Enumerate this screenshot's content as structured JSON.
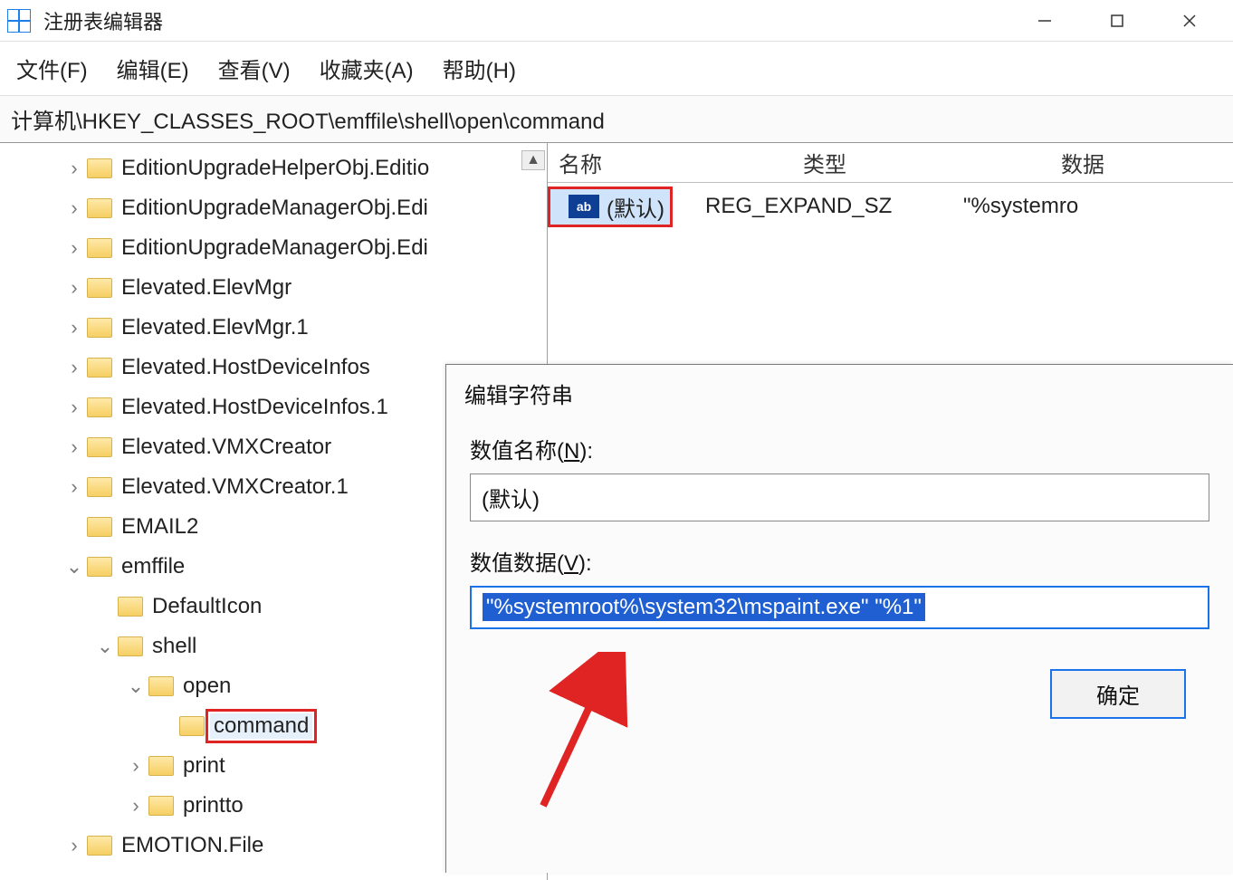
{
  "window": {
    "title": "注册表编辑器"
  },
  "menu": {
    "file": "文件(F)",
    "edit": "编辑(E)",
    "view": "查看(V)",
    "fav": "收藏夹(A)",
    "help": "帮助(H)"
  },
  "address": "计算机\\HKEY_CLASSES_ROOT\\emffile\\shell\\open\\command",
  "tree": [
    {
      "indent": 2,
      "exp": "closed",
      "label": "EditionUpgradeHelperObj.Editio"
    },
    {
      "indent": 2,
      "exp": "closed",
      "label": "EditionUpgradeManagerObj.Edi"
    },
    {
      "indent": 2,
      "exp": "closed",
      "label": "EditionUpgradeManagerObj.Edi"
    },
    {
      "indent": 2,
      "exp": "closed",
      "label": "Elevated.ElevMgr"
    },
    {
      "indent": 2,
      "exp": "closed",
      "label": "Elevated.ElevMgr.1"
    },
    {
      "indent": 2,
      "exp": "closed",
      "label": "Elevated.HostDeviceInfos"
    },
    {
      "indent": 2,
      "exp": "closed",
      "label": "Elevated.HostDeviceInfos.1"
    },
    {
      "indent": 2,
      "exp": "closed",
      "label": "Elevated.VMXCreator"
    },
    {
      "indent": 2,
      "exp": "closed",
      "label": "Elevated.VMXCreator.1"
    },
    {
      "indent": 2,
      "exp": "none",
      "label": "EMAIL2"
    },
    {
      "indent": 2,
      "exp": "open",
      "label": "emffile"
    },
    {
      "indent": 3,
      "exp": "none",
      "label": "DefaultIcon"
    },
    {
      "indent": 3,
      "exp": "open",
      "label": "shell"
    },
    {
      "indent": 4,
      "exp": "open",
      "label": "open"
    },
    {
      "indent": 5,
      "exp": "none",
      "label": "command",
      "selected": true
    },
    {
      "indent": 4,
      "exp": "closed",
      "label": "print"
    },
    {
      "indent": 4,
      "exp": "closed",
      "label": "printto"
    },
    {
      "indent": 2,
      "exp": "closed",
      "label": "EMOTION.File"
    }
  ],
  "list": {
    "hdr_name": "名称",
    "hdr_type": "类型",
    "hdr_data": "数据",
    "row": {
      "icon_text": "ab",
      "name": "(默认)",
      "type": "REG_EXPAND_SZ",
      "data": "\"%systemro"
    }
  },
  "dialog": {
    "title": "编辑字符串",
    "name_label_pre": "数值名称(",
    "name_label_u": "N",
    "name_label_post": "):",
    "name_value": "(默认)",
    "data_label_pre": "数值数据(",
    "data_label_u": "V",
    "data_label_post": "):",
    "data_value": "\"%systemroot%\\system32\\mspaint.exe\" \"%1\"",
    "ok": "确定"
  },
  "scroll_up": "▲"
}
